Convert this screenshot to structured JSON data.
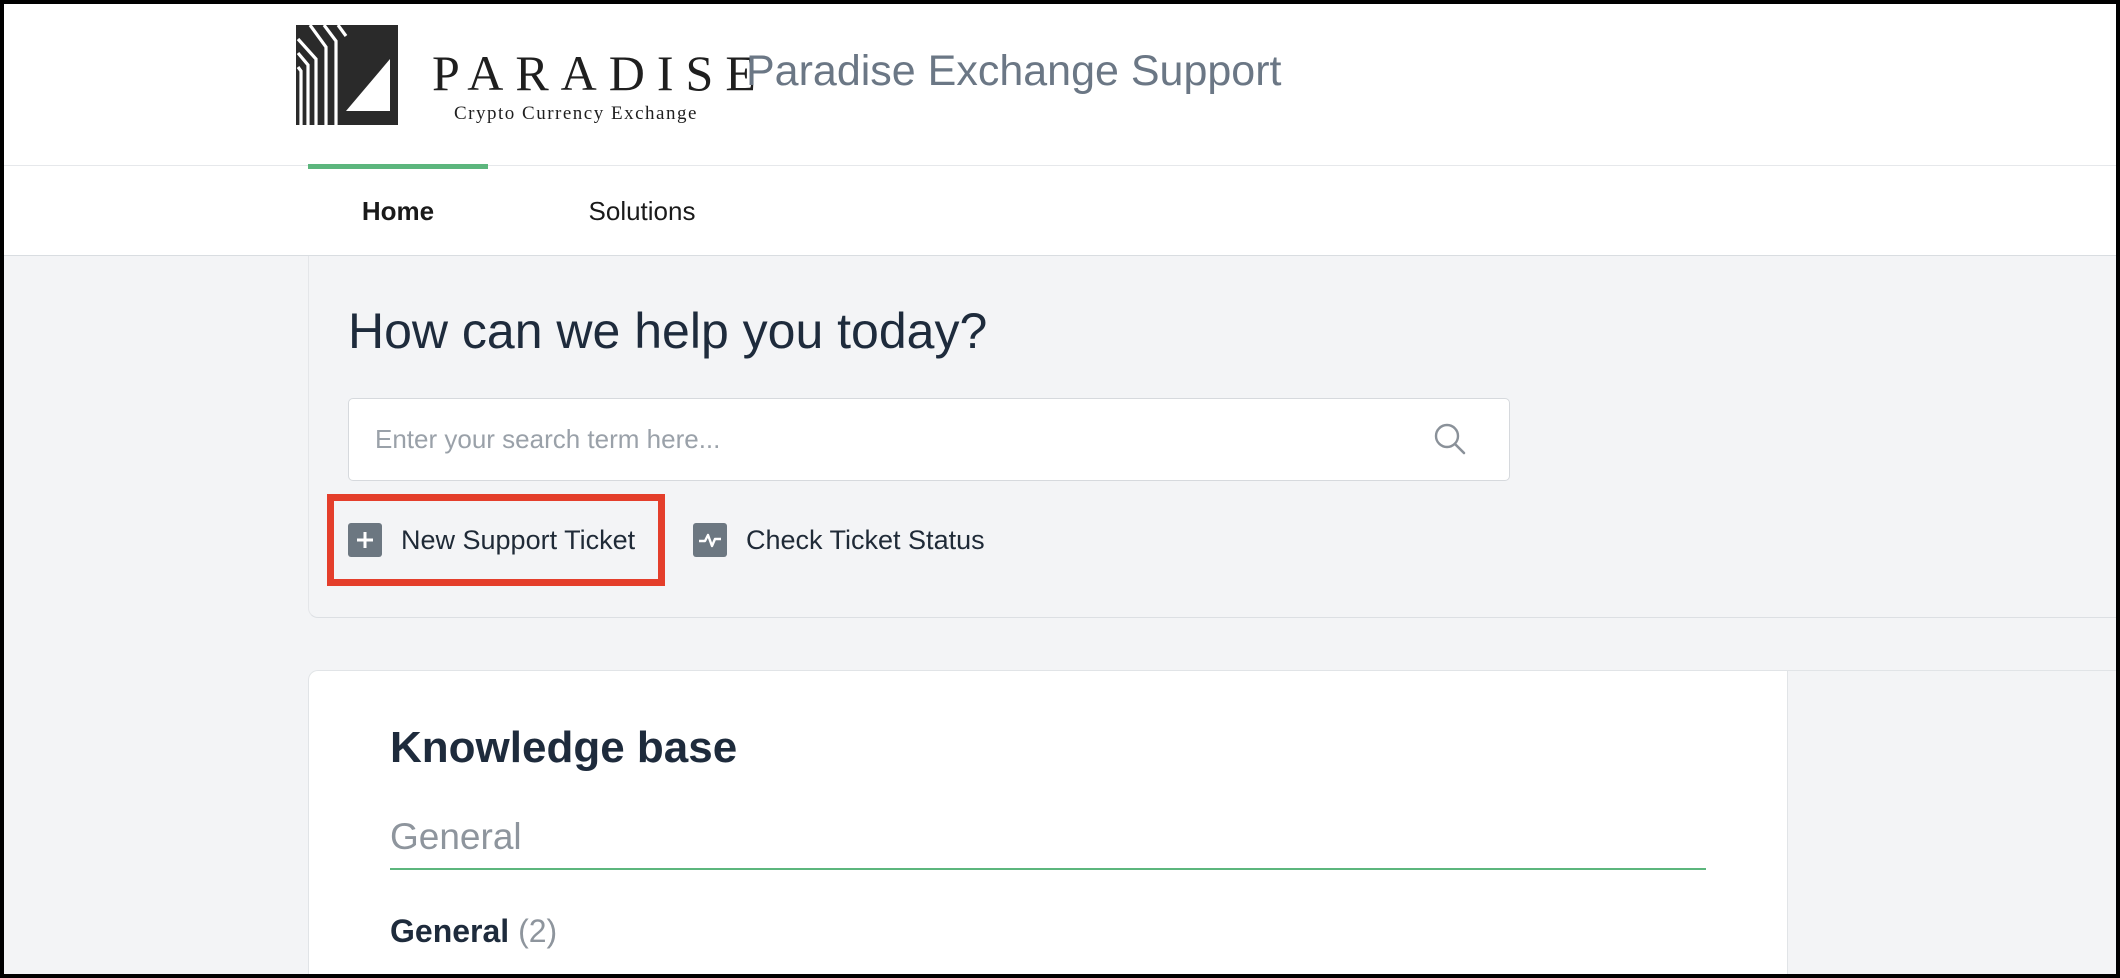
{
  "brand": {
    "logo_text": "PARADISE",
    "logo_subtitle": "Crypto Currency Exchange",
    "site_title": "Paradise Exchange Support",
    "accent_color": "#5cb67d"
  },
  "nav": {
    "tabs": [
      {
        "label": "Home",
        "active": true
      },
      {
        "label": "Solutions",
        "active": false
      }
    ]
  },
  "hero": {
    "headline": "How can we help you today?",
    "search": {
      "placeholder": "Enter your search term here...",
      "value": "",
      "icon": "search-icon"
    },
    "actions": [
      {
        "label": "New Support Ticket",
        "icon": "plus-icon",
        "highlighted": true,
        "highlight_color": "#e43e2b"
      },
      {
        "label": "Check Ticket Status",
        "icon": "pulse-icon",
        "highlighted": false
      }
    ]
  },
  "knowledge_base": {
    "title": "Knowledge base",
    "active_tab": "General",
    "categories": [
      {
        "name": "General",
        "count": "(2)"
      }
    ]
  }
}
